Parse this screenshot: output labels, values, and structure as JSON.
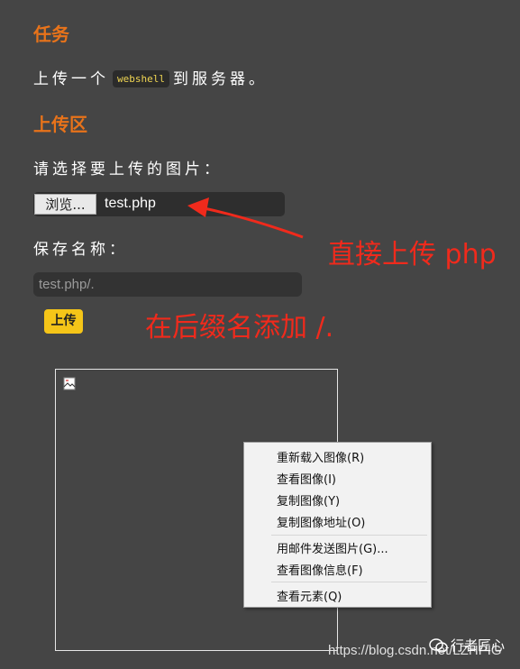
{
  "task": {
    "heading": "任务",
    "text_before": "上传一个",
    "code": "webshell",
    "text_after": "到服务器。"
  },
  "upload": {
    "heading": "上传区",
    "select_label": "请选择要上传的图片：",
    "browse_label": "浏览...",
    "file_name": "test.php",
    "save_label": "保存名称：",
    "save_value": "test.php/.",
    "submit_label": "上传"
  },
  "annotations": {
    "arrow_note": "直接上传 php",
    "suffix_note": "在后缀名添加 /."
  },
  "context_menu": {
    "items": [
      "重新载入图像(R)",
      "查看图像(I)",
      "复制图像(Y)",
      "复制图像地址(O)",
      "用邮件发送图片(G)...",
      "查看图像信息(F)",
      "查看元素(Q)"
    ]
  },
  "watermark": {
    "url": "https://blog.csdn.net/LZHPIG",
    "brand": "行者匠心"
  },
  "colors": {
    "background": "#454545",
    "heading": "#e8731a",
    "code_text": "#f0d653",
    "annotation": "#f02a1c",
    "button": "#f5c518"
  }
}
